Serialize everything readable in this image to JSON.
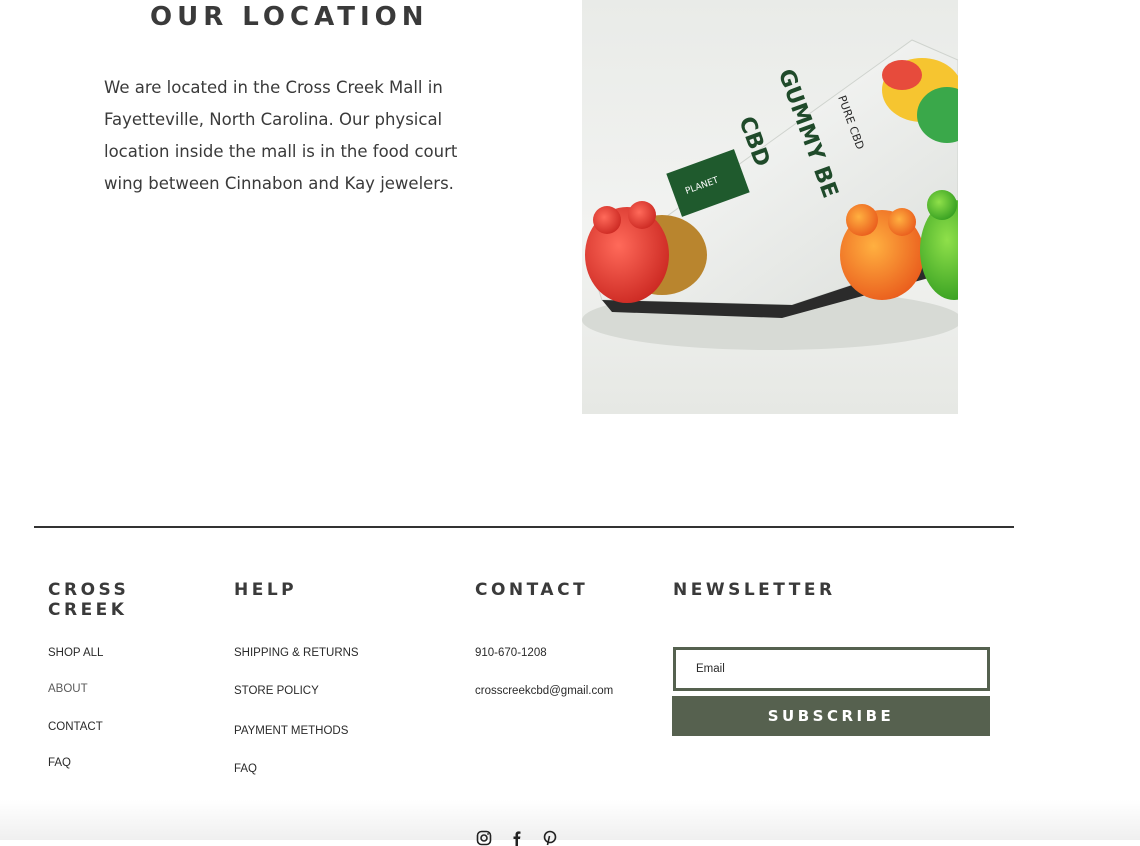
{
  "location": {
    "title": "OUR LOCATION",
    "body": "We are located in the Cross Creek Mall in Fayetteville, North Carolina. Our physical location inside the mall is in the food court wing between Cinnabon and Kay jewelers."
  },
  "photo": {
    "package_text_1": "GUMMY BE",
    "package_text_2": "CBD",
    "package_text_3": "PURE CBD",
    "package_text_4": "PLANET"
  },
  "footer": {
    "brand": {
      "title_line1": "CROSS",
      "title_line2": "CREEK",
      "links": [
        "SHOP ALL",
        "ABOUT",
        "CONTACT",
        "FAQ"
      ]
    },
    "help": {
      "title": "HELP",
      "links": [
        "SHIPPING & RETURNS",
        "STORE POLICY",
        "PAYMENT METHODS",
        "FAQ"
      ]
    },
    "contact": {
      "title": "CONTACT",
      "phone": "910-670-1208",
      "email": "crosscreekcbd@gmail.com"
    },
    "newsletter": {
      "title": "NEWSLETTER",
      "email_placeholder": "Email",
      "subscribe_label": "SUBSCRIBE"
    },
    "social_icons": [
      "instagram-icon",
      "facebook-icon",
      "pinterest-icon"
    ]
  },
  "colors": {
    "accent": "#56614f",
    "text": "#3a3a3a",
    "divider": "#333333"
  }
}
